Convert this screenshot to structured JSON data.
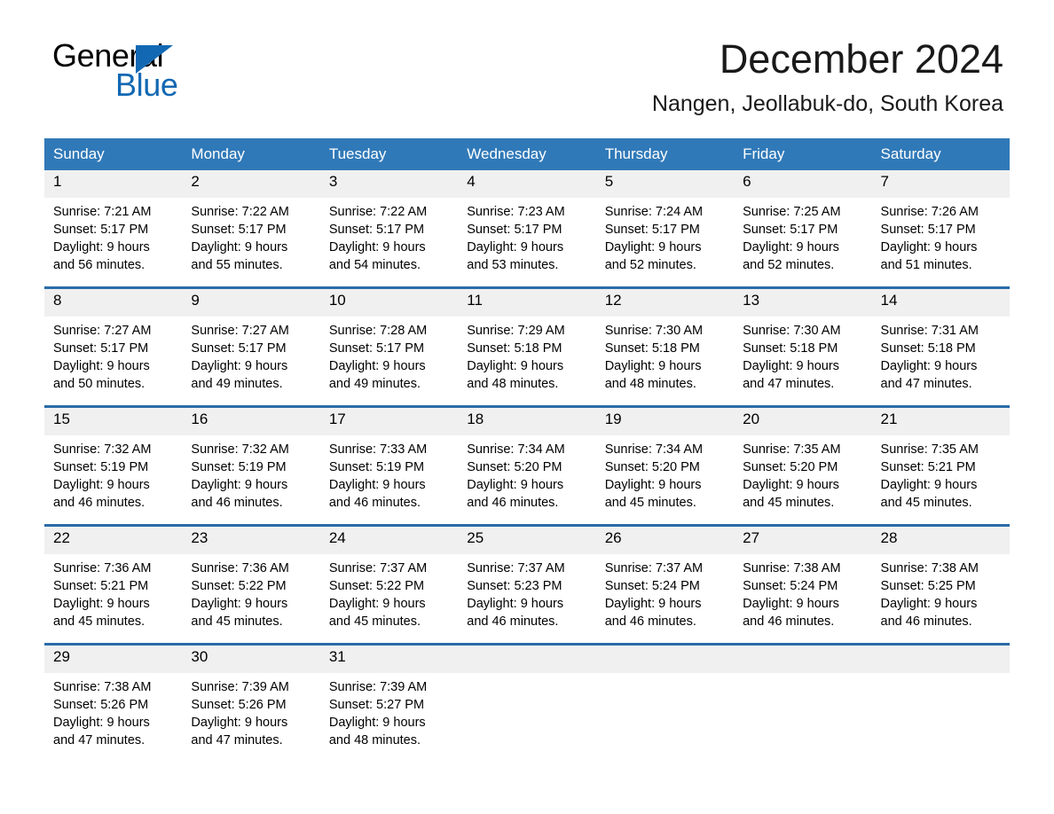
{
  "logo": {
    "word_general": "General",
    "word_blue": "Blue",
    "accent_color": "#1268b3"
  },
  "header": {
    "title": "December 2024",
    "subtitle": "Nangen, Jeollabuk-do, South Korea"
  },
  "theme": {
    "header_row_bg": "#3079b8",
    "week_divider": "#2b6ca8",
    "daynum_bg": "#f0f0f0",
    "text": "#000000"
  },
  "weekday_headers": [
    "Sunday",
    "Monday",
    "Tuesday",
    "Wednesday",
    "Thursday",
    "Friday",
    "Saturday"
  ],
  "labels": {
    "sunrise_prefix": "Sunrise:",
    "sunset_prefix": "Sunset:",
    "daylight_prefix": "Daylight:"
  },
  "weeks": [
    [
      {
        "day": "1",
        "sunrise": "Sunrise: 7:21 AM",
        "sunset": "Sunset: 5:17 PM",
        "daylight_line1": "Daylight: 9 hours",
        "daylight_line2": "and 56 minutes."
      },
      {
        "day": "2",
        "sunrise": "Sunrise: 7:22 AM",
        "sunset": "Sunset: 5:17 PM",
        "daylight_line1": "Daylight: 9 hours",
        "daylight_line2": "and 55 minutes."
      },
      {
        "day": "3",
        "sunrise": "Sunrise: 7:22 AM",
        "sunset": "Sunset: 5:17 PM",
        "daylight_line1": "Daylight: 9 hours",
        "daylight_line2": "and 54 minutes."
      },
      {
        "day": "4",
        "sunrise": "Sunrise: 7:23 AM",
        "sunset": "Sunset: 5:17 PM",
        "daylight_line1": "Daylight: 9 hours",
        "daylight_line2": "and 53 minutes."
      },
      {
        "day": "5",
        "sunrise": "Sunrise: 7:24 AM",
        "sunset": "Sunset: 5:17 PM",
        "daylight_line1": "Daylight: 9 hours",
        "daylight_line2": "and 52 minutes."
      },
      {
        "day": "6",
        "sunrise": "Sunrise: 7:25 AM",
        "sunset": "Sunset: 5:17 PM",
        "daylight_line1": "Daylight: 9 hours",
        "daylight_line2": "and 52 minutes."
      },
      {
        "day": "7",
        "sunrise": "Sunrise: 7:26 AM",
        "sunset": "Sunset: 5:17 PM",
        "daylight_line1": "Daylight: 9 hours",
        "daylight_line2": "and 51 minutes."
      }
    ],
    [
      {
        "day": "8",
        "sunrise": "Sunrise: 7:27 AM",
        "sunset": "Sunset: 5:17 PM",
        "daylight_line1": "Daylight: 9 hours",
        "daylight_line2": "and 50 minutes."
      },
      {
        "day": "9",
        "sunrise": "Sunrise: 7:27 AM",
        "sunset": "Sunset: 5:17 PM",
        "daylight_line1": "Daylight: 9 hours",
        "daylight_line2": "and 49 minutes."
      },
      {
        "day": "10",
        "sunrise": "Sunrise: 7:28 AM",
        "sunset": "Sunset: 5:17 PM",
        "daylight_line1": "Daylight: 9 hours",
        "daylight_line2": "and 49 minutes."
      },
      {
        "day": "11",
        "sunrise": "Sunrise: 7:29 AM",
        "sunset": "Sunset: 5:18 PM",
        "daylight_line1": "Daylight: 9 hours",
        "daylight_line2": "and 48 minutes."
      },
      {
        "day": "12",
        "sunrise": "Sunrise: 7:30 AM",
        "sunset": "Sunset: 5:18 PM",
        "daylight_line1": "Daylight: 9 hours",
        "daylight_line2": "and 48 minutes."
      },
      {
        "day": "13",
        "sunrise": "Sunrise: 7:30 AM",
        "sunset": "Sunset: 5:18 PM",
        "daylight_line1": "Daylight: 9 hours",
        "daylight_line2": "and 47 minutes."
      },
      {
        "day": "14",
        "sunrise": "Sunrise: 7:31 AM",
        "sunset": "Sunset: 5:18 PM",
        "daylight_line1": "Daylight: 9 hours",
        "daylight_line2": "and 47 minutes."
      }
    ],
    [
      {
        "day": "15",
        "sunrise": "Sunrise: 7:32 AM",
        "sunset": "Sunset: 5:19 PM",
        "daylight_line1": "Daylight: 9 hours",
        "daylight_line2": "and 46 minutes."
      },
      {
        "day": "16",
        "sunrise": "Sunrise: 7:32 AM",
        "sunset": "Sunset: 5:19 PM",
        "daylight_line1": "Daylight: 9 hours",
        "daylight_line2": "and 46 minutes."
      },
      {
        "day": "17",
        "sunrise": "Sunrise: 7:33 AM",
        "sunset": "Sunset: 5:19 PM",
        "daylight_line1": "Daylight: 9 hours",
        "daylight_line2": "and 46 minutes."
      },
      {
        "day": "18",
        "sunrise": "Sunrise: 7:34 AM",
        "sunset": "Sunset: 5:20 PM",
        "daylight_line1": "Daylight: 9 hours",
        "daylight_line2": "and 46 minutes."
      },
      {
        "day": "19",
        "sunrise": "Sunrise: 7:34 AM",
        "sunset": "Sunset: 5:20 PM",
        "daylight_line1": "Daylight: 9 hours",
        "daylight_line2": "and 45 minutes."
      },
      {
        "day": "20",
        "sunrise": "Sunrise: 7:35 AM",
        "sunset": "Sunset: 5:20 PM",
        "daylight_line1": "Daylight: 9 hours",
        "daylight_line2": "and 45 minutes."
      },
      {
        "day": "21",
        "sunrise": "Sunrise: 7:35 AM",
        "sunset": "Sunset: 5:21 PM",
        "daylight_line1": "Daylight: 9 hours",
        "daylight_line2": "and 45 minutes."
      }
    ],
    [
      {
        "day": "22",
        "sunrise": "Sunrise: 7:36 AM",
        "sunset": "Sunset: 5:21 PM",
        "daylight_line1": "Daylight: 9 hours",
        "daylight_line2": "and 45 minutes."
      },
      {
        "day": "23",
        "sunrise": "Sunrise: 7:36 AM",
        "sunset": "Sunset: 5:22 PM",
        "daylight_line1": "Daylight: 9 hours",
        "daylight_line2": "and 45 minutes."
      },
      {
        "day": "24",
        "sunrise": "Sunrise: 7:37 AM",
        "sunset": "Sunset: 5:22 PM",
        "daylight_line1": "Daylight: 9 hours",
        "daylight_line2": "and 45 minutes."
      },
      {
        "day": "25",
        "sunrise": "Sunrise: 7:37 AM",
        "sunset": "Sunset: 5:23 PM",
        "daylight_line1": "Daylight: 9 hours",
        "daylight_line2": "and 46 minutes."
      },
      {
        "day": "26",
        "sunrise": "Sunrise: 7:37 AM",
        "sunset": "Sunset: 5:24 PM",
        "daylight_line1": "Daylight: 9 hours",
        "daylight_line2": "and 46 minutes."
      },
      {
        "day": "27",
        "sunrise": "Sunrise: 7:38 AM",
        "sunset": "Sunset: 5:24 PM",
        "daylight_line1": "Daylight: 9 hours",
        "daylight_line2": "and 46 minutes."
      },
      {
        "day": "28",
        "sunrise": "Sunrise: 7:38 AM",
        "sunset": "Sunset: 5:25 PM",
        "daylight_line1": "Daylight: 9 hours",
        "daylight_line2": "and 46 minutes."
      }
    ],
    [
      {
        "day": "29",
        "sunrise": "Sunrise: 7:38 AM",
        "sunset": "Sunset: 5:26 PM",
        "daylight_line1": "Daylight: 9 hours",
        "daylight_line2": "and 47 minutes."
      },
      {
        "day": "30",
        "sunrise": "Sunrise: 7:39 AM",
        "sunset": "Sunset: 5:26 PM",
        "daylight_line1": "Daylight: 9 hours",
        "daylight_line2": "and 47 minutes."
      },
      {
        "day": "31",
        "sunrise": "Sunrise: 7:39 AM",
        "sunset": "Sunset: 5:27 PM",
        "daylight_line1": "Daylight: 9 hours",
        "daylight_line2": "and 48 minutes."
      },
      {
        "day": "",
        "sunrise": "",
        "sunset": "",
        "daylight_line1": "",
        "daylight_line2": ""
      },
      {
        "day": "",
        "sunrise": "",
        "sunset": "",
        "daylight_line1": "",
        "daylight_line2": ""
      },
      {
        "day": "",
        "sunrise": "",
        "sunset": "",
        "daylight_line1": "",
        "daylight_line2": ""
      },
      {
        "day": "",
        "sunrise": "",
        "sunset": "",
        "daylight_line1": "",
        "daylight_line2": ""
      }
    ]
  ]
}
